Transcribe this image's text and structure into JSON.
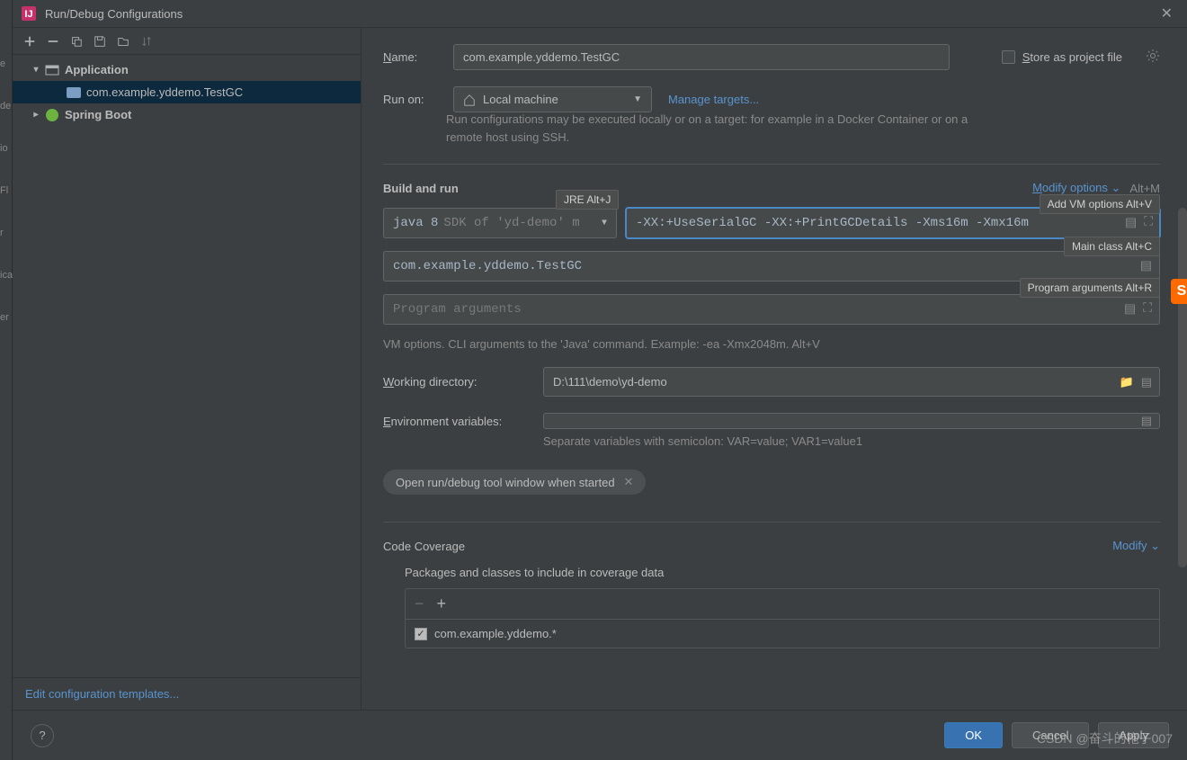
{
  "window": {
    "title": "Run/Debug Configurations"
  },
  "leftSliver": {
    "items": [
      "e",
      "de",
      "io",
      "Fl",
      "r",
      "ica",
      "er"
    ]
  },
  "toolbar": {
    "add": "+",
    "remove": "−",
    "copy": "⿻",
    "save": "💾",
    "folder": "📁",
    "sort": "↕"
  },
  "tree": {
    "application": {
      "label": "Application",
      "expanded": true
    },
    "application_child": {
      "label": "com.example.yddemo.TestGC"
    },
    "springboot": {
      "label": "Spring Boot",
      "expanded": false
    }
  },
  "sidebarFooter": {
    "editTemplates": "Edit configuration templates..."
  },
  "form": {
    "nameLabel": "Name:",
    "nameValue": "com.example.yddemo.TestGC",
    "storeAsProjectFile": "Store as project file",
    "runOnLabel": "Run on:",
    "runOnValue": "Local machine",
    "manageTargets": "Manage targets...",
    "runOnHelp": "Run configurations may be executed locally or on a target: for example in a Docker Container or on a remote host using SSH.",
    "buildAndRun": "Build and run",
    "modifyOptions": "Modify options",
    "modifyShortcut": "Alt+M",
    "jreTooltip": "JRE Alt+J",
    "addVmTooltip": "Add VM options Alt+V",
    "mainClassTooltip": "Main class Alt+C",
    "progArgsTooltip": "Program arguments Alt+R",
    "jreJava": "java 8",
    "jreSdk": "SDK of 'yd-demo' m",
    "vmOptions": "-XX:+UseSerialGC -XX:+PrintGCDetails -Xms16m -Xmx16m",
    "mainClass": "com.example.yddemo.TestGC",
    "programArgsPlaceholder": "Program arguments",
    "vmHint": "VM options. CLI arguments to the 'Java' command. Example: -ea -Xmx2048m. Alt+V",
    "workingDirLabel": "Working directory:",
    "workingDir": "D:\\111\\demo\\yd-demo",
    "envLabel": "Environment variables:",
    "envHelp": "Separate variables with semicolon: VAR=value; VAR1=value1",
    "chipLabel": "Open run/debug tool window when started",
    "codeCoverage": "Code Coverage",
    "modify": "Modify",
    "packagesLabel": "Packages and classes to include in coverage data",
    "coverageEntry": "com.example.yddemo.*"
  },
  "footer": {
    "ok": "OK",
    "cancel": "Cancel",
    "apply": "Apply"
  },
  "watermark": "CSDN @奋斗的袍子007"
}
